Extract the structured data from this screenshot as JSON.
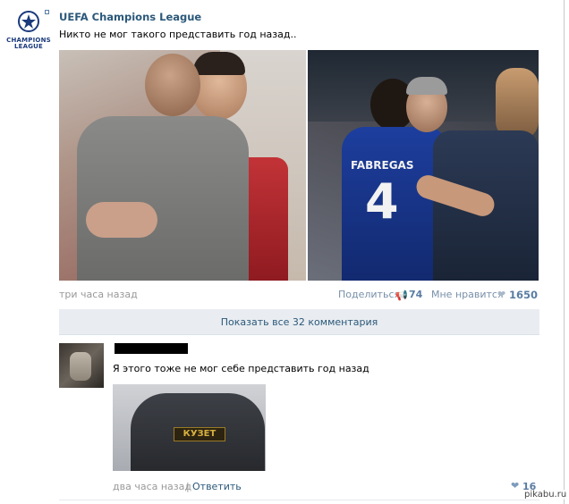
{
  "post": {
    "author": "UEFA Champions League",
    "logo_text": [
      "CHAMPIONS",
      "LEAGUE"
    ],
    "text": "Никто не мог такого представить год назад..",
    "time": "три часа назад",
    "share_label": "Поделиться",
    "share_count": "74",
    "like_label": "Мне нравится",
    "like_count": "1650",
    "photo_right_jersey": "FABREGAS",
    "photo_right_number": "4"
  },
  "comments_bar": {
    "label": "Показать все 32 комментария"
  },
  "comment": {
    "text": "Я этого тоже не мог себе представить год назад",
    "photo_patch": "КУЗЕТ",
    "time": "два часа назад",
    "separator": "|",
    "reply_label": "Ответить",
    "like_count": "16"
  },
  "watermark": "pikabu.ru",
  "icons": {
    "share": "megaphone-icon",
    "like": "heart-icon"
  },
  "colors": {
    "link": "#2b587a",
    "muted": "#999999",
    "bar_bg": "#e9edf1"
  }
}
